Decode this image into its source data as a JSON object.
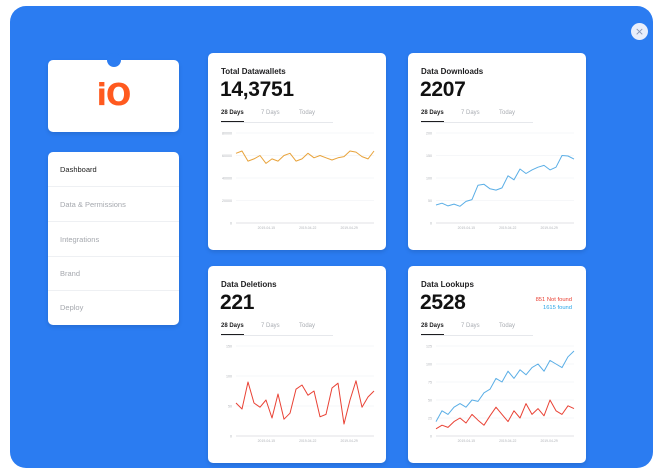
{
  "close_icon": "×",
  "logo": {
    "text": "iO",
    "color": "#ff5a1f"
  },
  "nav": {
    "items": [
      {
        "label": "Dashboard",
        "active": true
      },
      {
        "label": "Data & Permissions",
        "active": false
      },
      {
        "label": "Integrations",
        "active": false
      },
      {
        "label": "Brand",
        "active": false
      },
      {
        "label": "Deploy",
        "active": false
      }
    ]
  },
  "colors": {
    "background": "#2b7cf1",
    "orange": "#e8a33b",
    "blue": "#5aaee6",
    "red": "#e94235"
  },
  "tabs": [
    "28 Days",
    "7 Days",
    "Today"
  ],
  "cards": [
    {
      "title": "Total Datawallets",
      "value": "14,3751",
      "chart_data": {
        "type": "line",
        "y_ticks": [
          "80000",
          "60000",
          "40000",
          "20000",
          "0"
        ],
        "ylim": [
          0,
          80000
        ],
        "x_ticks": [
          "2019-04-15",
          "2019-04-22",
          "2019-04-29"
        ],
        "series": [
          {
            "color": "#e8a33b",
            "values": [
              62000,
              64000,
              55000,
              57000,
              60000,
              53000,
              57000,
              55000,
              60000,
              62000,
              55000,
              57000,
              62000,
              58000,
              60000,
              58000,
              56000,
              58000,
              59000,
              64000,
              63000,
              59000,
              57000,
              64000
            ]
          }
        ]
      }
    },
    {
      "title": "Data Downloads",
      "value": "2207",
      "chart_data": {
        "type": "line",
        "y_ticks": [
          "200",
          "150",
          "100",
          "50",
          "0"
        ],
        "ylim": [
          0,
          200
        ],
        "x_ticks": [
          "2019-04-15",
          "2019-04-22",
          "2019-04-29"
        ],
        "series": [
          {
            "color": "#5aaee6",
            "values": [
              40,
              44,
              38,
              42,
              37,
              48,
              52,
              84,
              86,
              76,
              73,
              78,
              105,
              96,
              120,
              110,
              118,
              124,
              128,
              118,
              124,
              150,
              149,
              142
            ]
          }
        ]
      }
    },
    {
      "title": "Data Deletions",
      "value": "221",
      "chart_data": {
        "type": "line",
        "y_ticks": [
          "150",
          "100",
          "50",
          "0"
        ],
        "ylim": [
          0,
          150
        ],
        "x_ticks": [
          "2019-04-15",
          "2019-04-22",
          "2019-04-29"
        ],
        "series": [
          {
            "color": "#e94235",
            "values": [
              55,
              45,
              90,
              55,
              48,
              60,
              30,
              70,
              28,
              38,
              78,
              85,
              68,
              75,
              32,
              36,
              80,
              88,
              20,
              60,
              92,
              48,
              65,
              75
            ]
          }
        ]
      }
    },
    {
      "title": "Data Lookups",
      "value": "2528",
      "legend": {
        "red_text": "851 Not found",
        "blue_text": "1615 found"
      },
      "chart_data": {
        "type": "line",
        "y_ticks": [
          "125",
          "100",
          "75",
          "50",
          "25",
          "0"
        ],
        "ylim": [
          0,
          125
        ],
        "x_ticks": [
          "2019-04-15",
          "2019-04-22",
          "2019-04-29"
        ],
        "series": [
          {
            "name": "1615 found",
            "color": "#5aaee6",
            "values": [
              20,
              35,
              30,
              40,
              45,
              40,
              50,
              48,
              60,
              65,
              80,
              75,
              90,
              80,
              92,
              85,
              95,
              100,
              90,
              105,
              100,
              95,
              110,
              118
            ]
          },
          {
            "name": "851 Not found",
            "color": "#e94235",
            "values": [
              10,
              15,
              12,
              20,
              25,
              18,
              30,
              22,
              15,
              28,
              40,
              30,
              20,
              35,
              25,
              45,
              30,
              38,
              28,
              50,
              35,
              30,
              42,
              38
            ]
          }
        ]
      }
    }
  ]
}
